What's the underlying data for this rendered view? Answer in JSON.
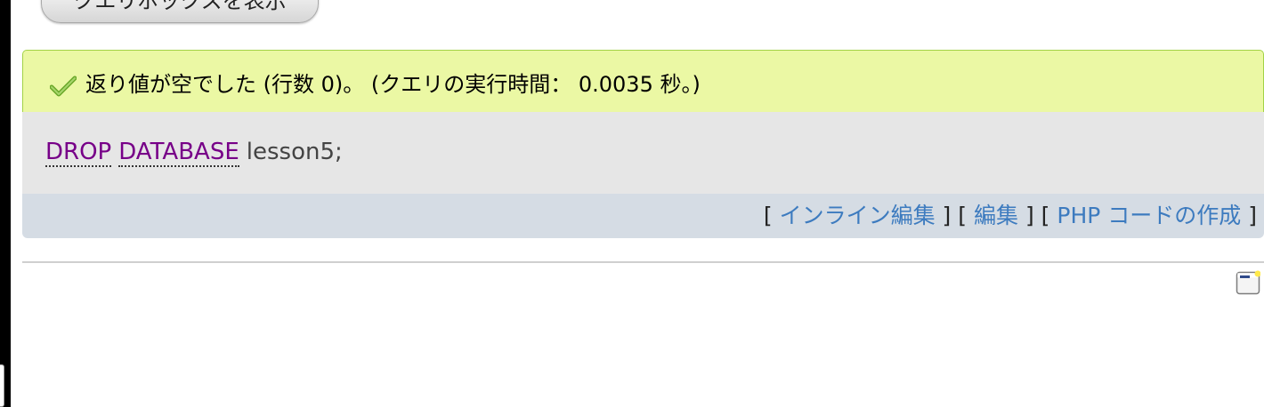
{
  "top_button": {
    "label": "クエリボックスを表示"
  },
  "result": {
    "message": "返り値が空でした (行数 0)。 (クエリの実行時間： 0.0035 秒。)",
    "status_icon": "check-icon",
    "colors": {
      "success_bg": "#ebf8a4",
      "success_border": "#a2d246",
      "sql_bg": "#e6e6e6",
      "action_bg": "#d5dce4",
      "keyword": "#770088",
      "link": "#3d7bbf"
    }
  },
  "sql": {
    "keyword_1": "DROP",
    "keyword_2": "DATABASE",
    "rest": "lesson5;"
  },
  "actions": {
    "open_bracket": "[",
    "close_bracket": "]",
    "inline_edit": "インライン編集",
    "edit": "編集",
    "create_php": "PHP コードの作成"
  },
  "footer": {
    "icon": "bookmark-icon"
  }
}
